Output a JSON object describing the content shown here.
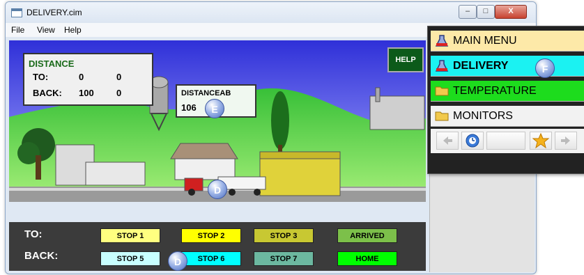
{
  "window": {
    "title": "DELIVERY.cim",
    "min_label": "–",
    "max_label": "□",
    "close_label": "X"
  },
  "menu": {
    "file": "File",
    "view": "View",
    "help": "Help"
  },
  "scene": {
    "distance_title": "DISTANCE",
    "to_label": "TO:",
    "to_value1": "0",
    "to_value2": "0",
    "back_label": "BACK:",
    "back_value1": "100",
    "back_value2": "0",
    "distanceab_label": "DISTANCEAB",
    "distanceab_value": "106",
    "help_button": "HELP"
  },
  "controls": {
    "to_label": "TO:",
    "back_label": "BACK:",
    "stop1": "STOP 1",
    "stop2": "STOP 2",
    "stop3": "STOP 3",
    "arrived": "ARRIVED",
    "stop5": "STOP 5",
    "stop6": "STOP 6",
    "stop7": "STOP 7",
    "home": "HOME"
  },
  "markers": {
    "e": "E",
    "d1": "D",
    "d2": "D",
    "f": "F"
  },
  "nav": {
    "main_menu": "MAIN MENU",
    "delivery": "DELIVERY",
    "temperature": "TEMPERATURE",
    "monitors": "MONITORS"
  },
  "colors": {
    "sky": "#4a4ce8",
    "grass": "#3ec43e",
    "stop1": "#ffff80",
    "stop2": "#ffff00",
    "stop3": "#c8c832",
    "arrived": "#7cc04a",
    "stop5": "#c8ffff",
    "stop6": "#00ffff",
    "stop7": "#6cb8a0",
    "home": "#00ff00",
    "main_menu_bg": "#fde9a8",
    "delivery_bg": "#1bf2f2",
    "temperature_bg": "#1ddc1d",
    "monitors_bg": "#f2f2f2"
  }
}
